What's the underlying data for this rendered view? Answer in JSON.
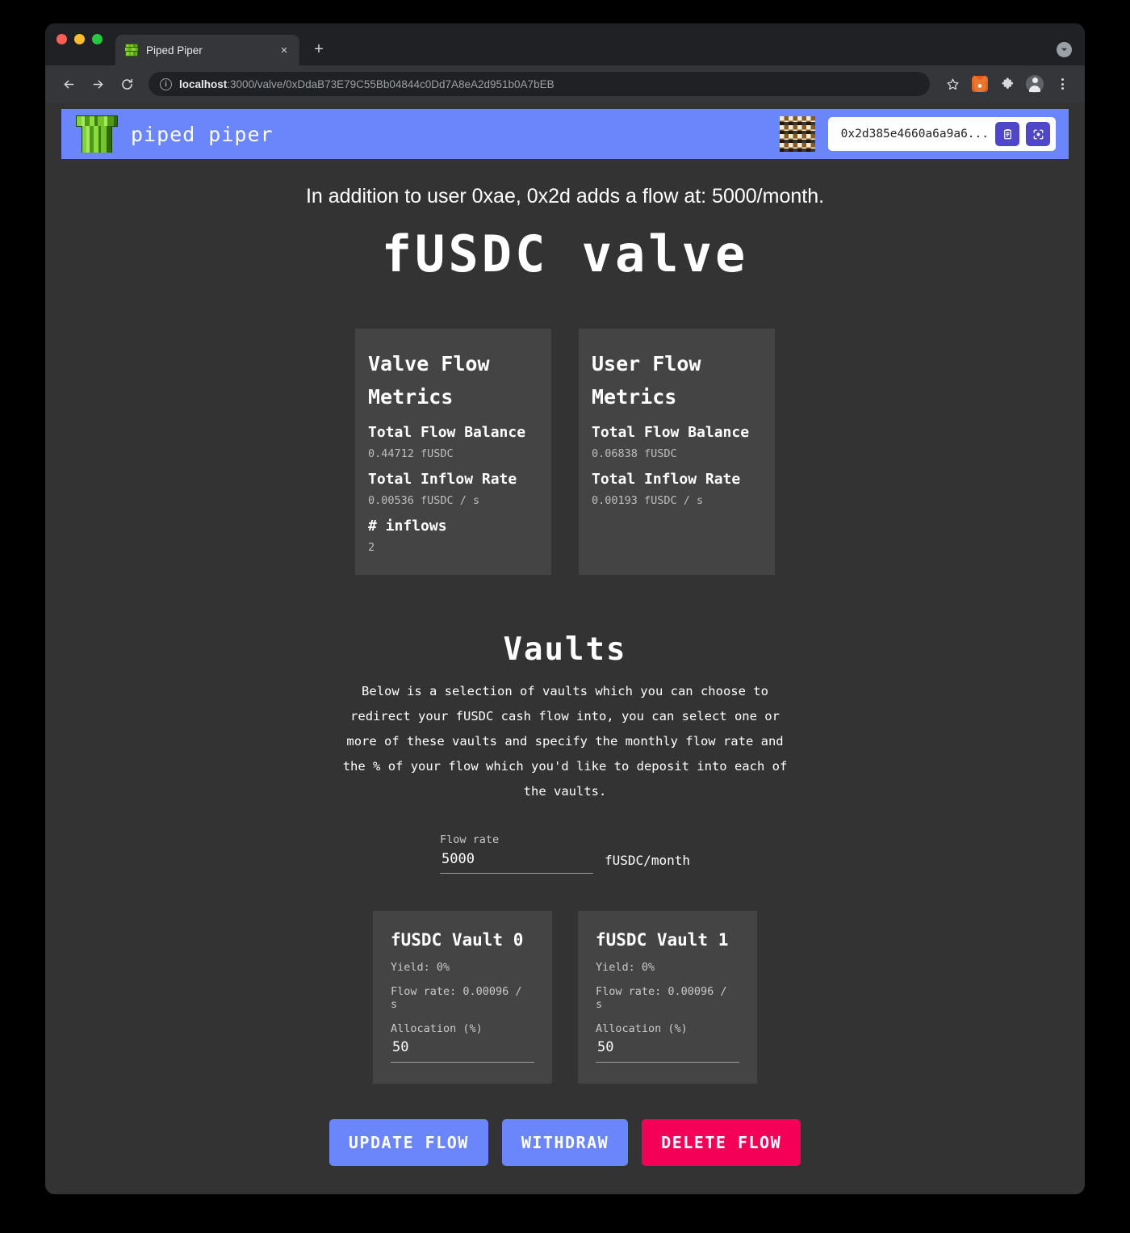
{
  "browser": {
    "tab": {
      "title": "Piped Piper",
      "favicon_name": "green-pipe-favicon",
      "close_label": "×"
    },
    "new_tab_label": "+",
    "url": {
      "host": "localhost",
      "path": ":3000/valve/0xDdaB73E79C55Bb04844c0Dd7A8eA2d951b0A7bEB"
    },
    "toolbar_icons": [
      "back-arrow-icon",
      "forward-arrow-icon",
      "reload-icon",
      "bookmark-star-icon",
      "metamask-fox-icon",
      "extensions-puzzle-icon",
      "profile-avatar-icon",
      "browser-menu-icon"
    ]
  },
  "app": {
    "brand": "piped piper",
    "logo_name": "mario-pipe-logo",
    "wallet": {
      "address": "0x2d385e4660a6a9a6...",
      "copy_icon": "clipboard-icon",
      "qr_icon": "qr-scan-icon",
      "identicon_name": "wallet-identicon"
    },
    "header_color": "#6B86FB"
  },
  "page": {
    "notice": "In addition to user 0xae, 0x2d adds a flow at: 5000/month.",
    "title": "fUSDC valve"
  },
  "metrics": [
    {
      "card_title": "Valve Flow Metrics",
      "rows": [
        {
          "label": "Total Flow Balance",
          "value": "0.44712 fUSDC"
        },
        {
          "label": "Total Inflow Rate",
          "value": "0.00536 fUSDC / s"
        },
        {
          "label": "# inflows",
          "value": "2"
        }
      ]
    },
    {
      "card_title": "User Flow Metrics",
      "rows": [
        {
          "label": "Total Flow Balance",
          "value": "0.06838 fUSDC"
        },
        {
          "label": "Total Inflow Rate",
          "value": "0.00193 fUSDC / s"
        }
      ]
    }
  ],
  "vaults_section": {
    "title": "Vaults",
    "description": "Below is a selection of vaults which you can choose to redirect your fUSDC cash flow into, you can select one or more of these vaults and specify the monthly flow rate and the % of your flow which you'd like to deposit into each of the vaults.",
    "flow_rate": {
      "label": "Flow rate",
      "value": "5000",
      "placeholder": "0",
      "unit": "fUSDC/month"
    },
    "vaults": [
      {
        "name": "fUSDC Vault 0",
        "yield": "Yield: 0%",
        "flow_rate": "Flow rate: 0.00096 / s",
        "allocation_label": "Allocation (%)",
        "allocation_value": "50",
        "allocation_placeholder": "0"
      },
      {
        "name": "fUSDC Vault 1",
        "yield": "Yield: 0%",
        "flow_rate": "Flow rate: 0.00096 / s",
        "allocation_label": "Allocation (%)",
        "allocation_value": "50",
        "allocation_placeholder": "0"
      }
    ]
  },
  "actions": {
    "update": "UPDATE FLOW",
    "withdraw": "WITHDRAW",
    "delete": "DELETE FLOW",
    "primary_color": "#6B86FB",
    "danger_color": "#F50057"
  }
}
